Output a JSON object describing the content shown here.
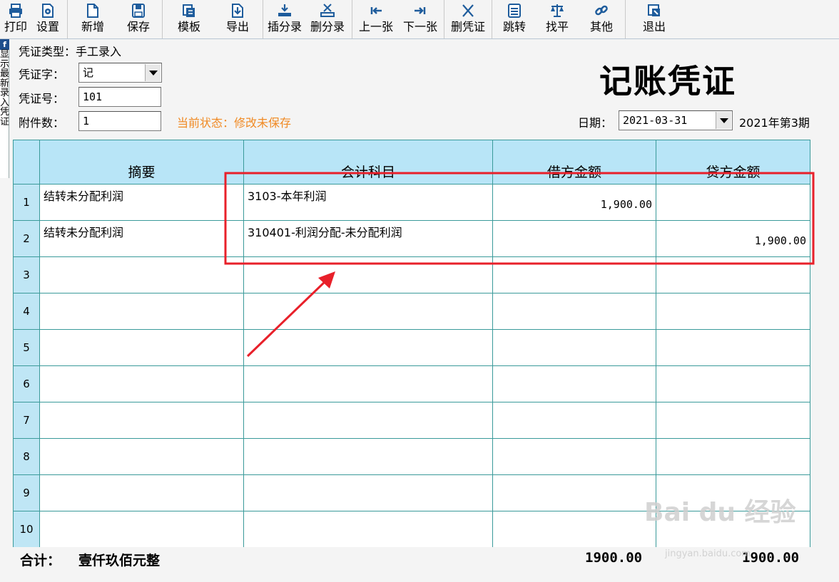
{
  "toolbar": {
    "buttons": [
      {
        "label": "打印",
        "icon": "printer-icon"
      },
      {
        "label": "设置",
        "icon": "settings-icon"
      },
      {
        "label": "新增",
        "icon": "new-document-icon"
      },
      {
        "label": "保存",
        "icon": "save-icon"
      },
      {
        "label": "模板",
        "icon": "template-icon"
      },
      {
        "label": "导出",
        "icon": "export-icon"
      },
      {
        "label": "插分录",
        "icon": "insert-entry-icon"
      },
      {
        "label": "删分录",
        "icon": "delete-entry-icon"
      },
      {
        "label": "上一张",
        "icon": "previous-icon"
      },
      {
        "label": "下一张",
        "icon": "next-icon"
      },
      {
        "label": "删凭证",
        "icon": "delete-voucher-icon"
      },
      {
        "label": "跳转",
        "icon": "jump-icon"
      },
      {
        "label": "找平",
        "icon": "balance-scale-icon"
      },
      {
        "label": "其他",
        "icon": "link-icon"
      },
      {
        "label": "退出",
        "icon": "exit-icon"
      }
    ]
  },
  "side_tab": {
    "flag": "f",
    "text": "显示最新录入凭证"
  },
  "header": {
    "voucher_type_label": "凭证类型：",
    "voucher_type_value": "手工录入",
    "word_label": "凭证字：",
    "word_value": "记",
    "number_label": "凭证号：",
    "number_value": "101",
    "attach_label": "附件数：",
    "attach_value": "1",
    "status_label": "当前状态：",
    "status_value": "修改未保存",
    "title": "记账凭证",
    "date_label": "日期：",
    "date_value": "2021-03-31",
    "period": "2021年第3期"
  },
  "grid": {
    "columns": [
      "摘要",
      "会计科目",
      "借方金额",
      "贷方金额"
    ],
    "rows": [
      {
        "num": "1",
        "summary": "结转未分配利润",
        "account": "3103-本年利润",
        "debit": "1,900.00",
        "credit": ""
      },
      {
        "num": "2",
        "summary": "结转未分配利润",
        "account": "310401-利润分配-未分配利润",
        "debit": "",
        "credit": "1,900.00"
      },
      {
        "num": "3",
        "summary": "",
        "account": "",
        "debit": "",
        "credit": ""
      },
      {
        "num": "4",
        "summary": "",
        "account": "",
        "debit": "",
        "credit": ""
      },
      {
        "num": "5",
        "summary": "",
        "account": "",
        "debit": "",
        "credit": ""
      },
      {
        "num": "6",
        "summary": "",
        "account": "",
        "debit": "",
        "credit": ""
      },
      {
        "num": "7",
        "summary": "",
        "account": "",
        "debit": "",
        "credit": ""
      },
      {
        "num": "8",
        "summary": "",
        "account": "",
        "debit": "",
        "credit": ""
      },
      {
        "num": "9",
        "summary": "",
        "account": "",
        "debit": "",
        "credit": ""
      },
      {
        "num": "10",
        "summary": "",
        "account": "",
        "debit": "",
        "credit": ""
      }
    ]
  },
  "footer": {
    "total_label": "合计：",
    "total_words": "壹仟玖佰元整",
    "debit_total": "1900.00",
    "credit_total": "1900.00"
  },
  "watermark": {
    "text": "Bai du 经验",
    "sub": "jingyan.baidu.com"
  },
  "colors": {
    "header_bg": "#b8e5f7",
    "grid_line": "#3a9a9a",
    "status": "#f08a24",
    "annotation": "#e8202a"
  }
}
